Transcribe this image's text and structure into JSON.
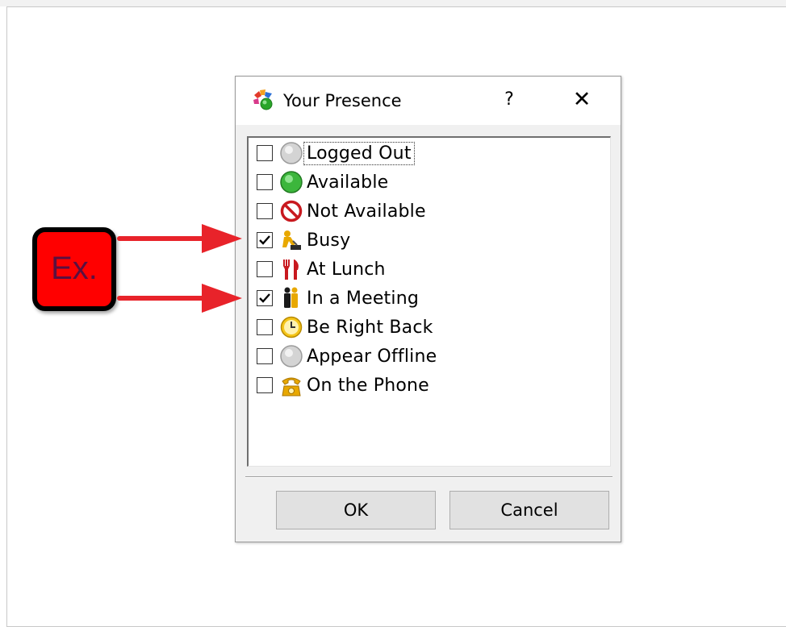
{
  "dialog": {
    "title": "Your Presence",
    "help_label": "?",
    "close_label": "✕"
  },
  "presence_options": [
    {
      "label": "Logged Out",
      "checked": false,
      "icon": "gray-circle-icon"
    },
    {
      "label": "Available",
      "checked": false,
      "icon": "green-circle-icon"
    },
    {
      "label": "Not Available",
      "checked": false,
      "icon": "no-entry-icon"
    },
    {
      "label": "Busy",
      "checked": true,
      "icon": "busy-worker-icon"
    },
    {
      "label": "At Lunch",
      "checked": false,
      "icon": "fork-knife-icon"
    },
    {
      "label": "In a Meeting",
      "checked": true,
      "icon": "meeting-people-icon"
    },
    {
      "label": "Be Right Back",
      "checked": false,
      "icon": "clock-icon"
    },
    {
      "label": "Appear Offline",
      "checked": false,
      "icon": "gray-circle-icon"
    },
    {
      "label": "On the Phone",
      "checked": false,
      "icon": "phone-icon"
    }
  ],
  "buttons": {
    "ok_label": "OK",
    "cancel_label": "Cancel"
  },
  "annotation": {
    "callout_text": "Ex.",
    "callout_color": "#ff0000",
    "arrow_color": "#e8232a"
  }
}
